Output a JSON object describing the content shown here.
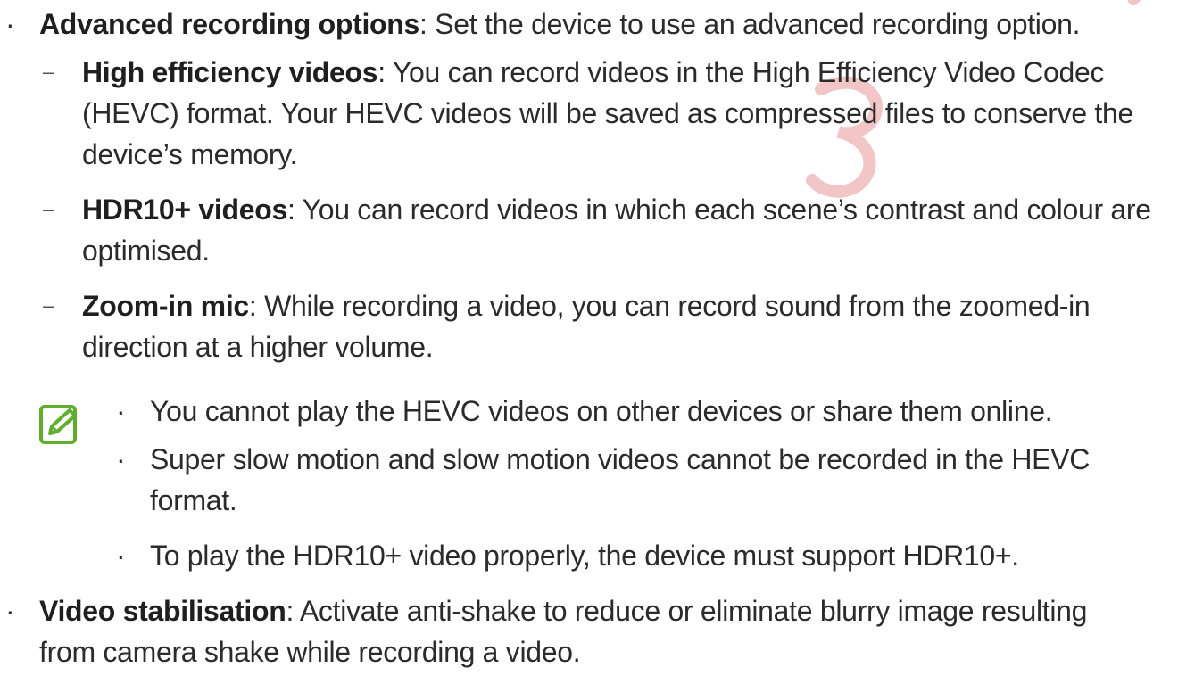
{
  "watermark": {
    "color": "#f2c6c6"
  },
  "items": [
    {
      "term": "Advanced recording options",
      "sep": ": ",
      "text": "Set the device to use an advanced recording option."
    },
    {
      "term": "High efficiency videos",
      "sep": ": ",
      "line1": "You can record videos in the High Efficiency Video Codec",
      "line2": "(HEVC) format. Your HEVC videos will be saved as compressed files to conserve the",
      "line3": "device’s memory."
    },
    {
      "term": "HDR10+ videos",
      "sep": ": ",
      "line1": "You can record videos in which each scene’s contrast and colour are",
      "line2": "optimised."
    },
    {
      "term": "Zoom-in mic",
      "sep": ": ",
      "line1": "While recording a video, you can record sound from the zoomed-in",
      "line2": "direction at a higher volume."
    }
  ],
  "note": {
    "icon": "note-pencil-icon",
    "accent": "#5fae2e",
    "bullets": [
      {
        "line1": "You cannot play the HEVC videos on other devices or share them online."
      },
      {
        "line1": "Super slow motion and slow motion videos cannot be recorded in the HEVC",
        "line2": "format."
      },
      {
        "line1": "To play the HDR10+ video properly, the device must support HDR10+."
      }
    ]
  },
  "last": {
    "term": "Video stabilisation",
    "sep": ": ",
    "line1": "Activate anti-shake to reduce or eliminate blurry image resulting",
    "line2": "from camera shake while recording a video."
  }
}
